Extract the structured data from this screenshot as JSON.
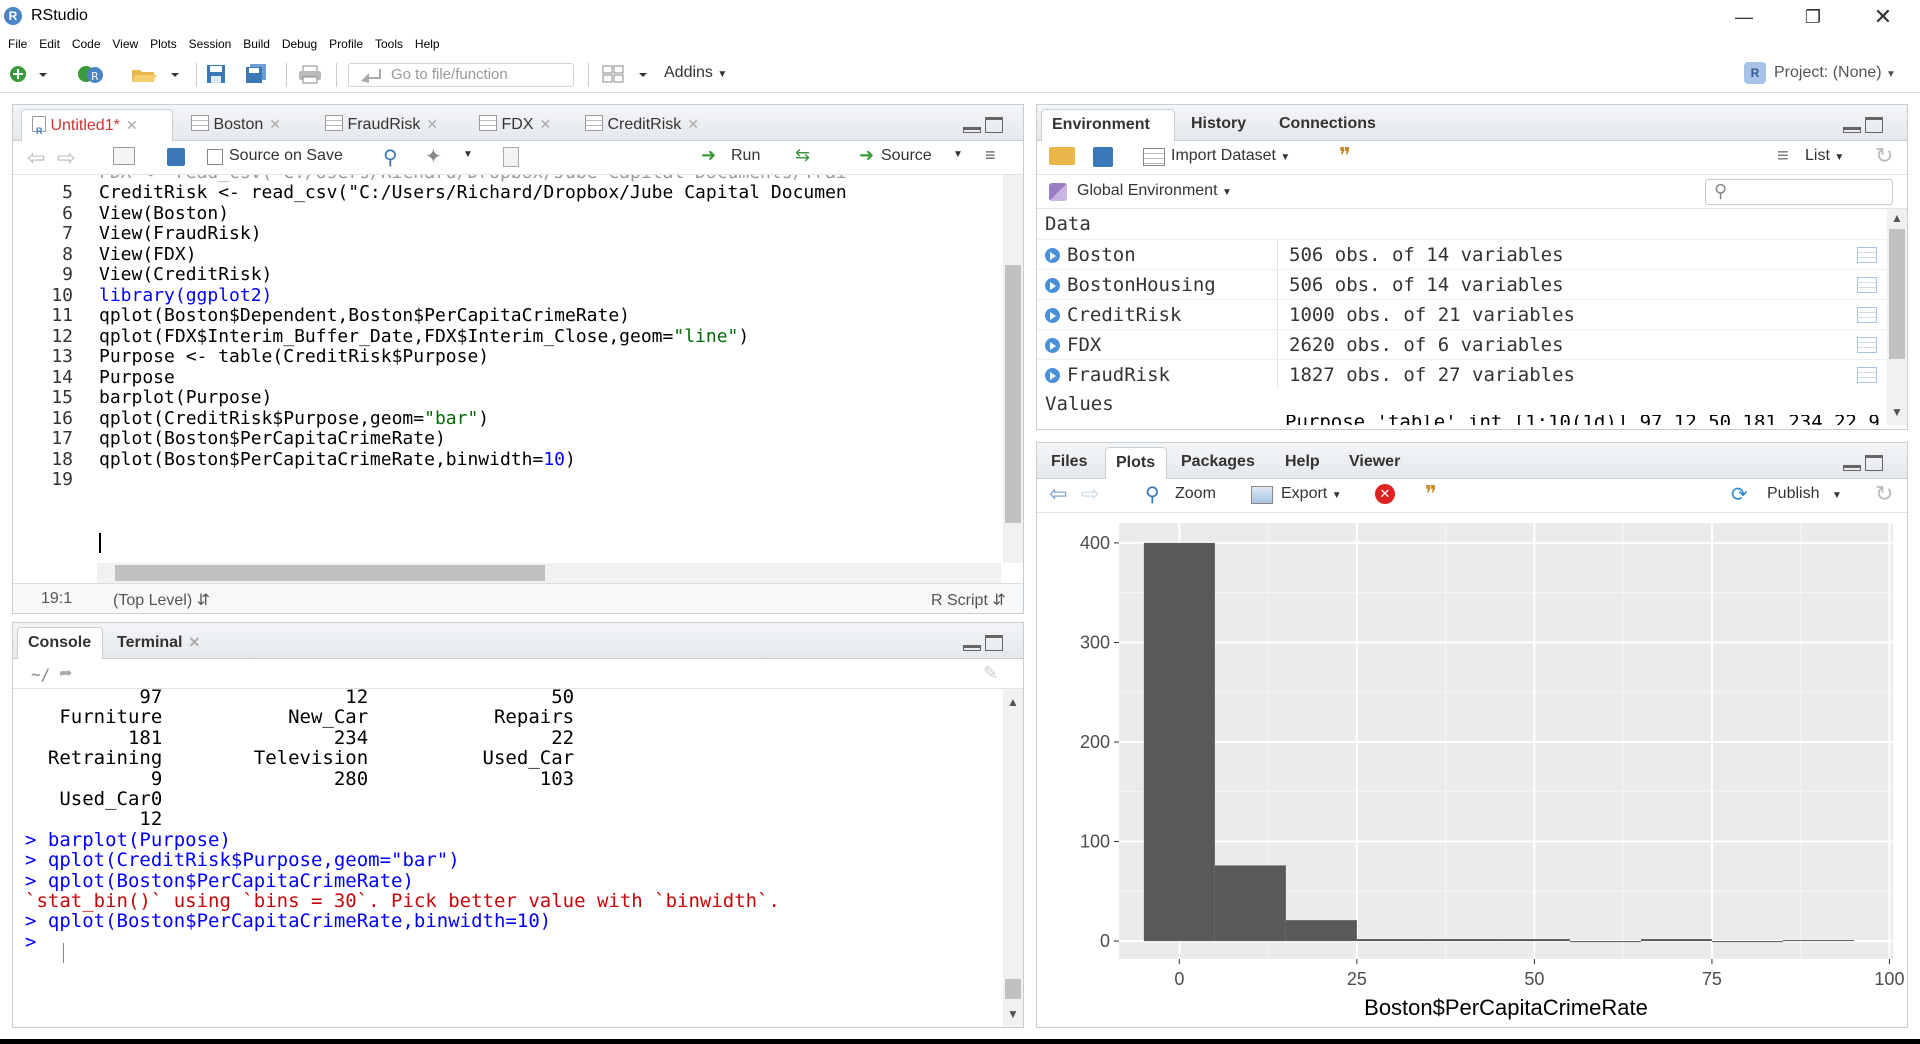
{
  "window": {
    "title": "RStudio",
    "app_icon": "R"
  },
  "menu": [
    "File",
    "Edit",
    "Code",
    "View",
    "Plots",
    "Session",
    "Build",
    "Debug",
    "Profile",
    "Tools",
    "Help"
  ],
  "toolbar": {
    "goto_placeholder": "Go to file/function",
    "addins": "Addins",
    "project": "Project: (None)"
  },
  "editor": {
    "tabs": [
      "Untitled1*",
      "Boston",
      "FraudRisk",
      "FDX",
      "CreditRisk"
    ],
    "toolbar": {
      "source_on_save": "Source on Save",
      "run": "Run",
      "source": "Source"
    },
    "lines": [
      {
        "n": "5",
        "t": "CreditRisk <- read_csv(\"C:/Users/Richard/Dropbox/Jube Capital Documen"
      },
      {
        "n": "6",
        "t": "View(Boston)"
      },
      {
        "n": "7",
        "t": "View(FraudRisk)"
      },
      {
        "n": "8",
        "t": "View(FDX)"
      },
      {
        "n": "9",
        "t": "View(CreditRisk)"
      },
      {
        "n": "10",
        "t": "library(ggplot2)"
      },
      {
        "n": "11",
        "t": "qplot(Boston$Dependent,Boston$PerCapitaCrimeRate)"
      },
      {
        "n": "12",
        "t": "qplot(FDX$Interim_Buffer_Date,FDX$Interim_Close,geom=\"line\")"
      },
      {
        "n": "13",
        "t": "Purpose <- table(CreditRisk$Purpose)"
      },
      {
        "n": "14",
        "t": "Purpose"
      },
      {
        "n": "15",
        "t": "barplot(Purpose)"
      },
      {
        "n": "16",
        "t": "qplot(CreditRisk$Purpose,geom=\"bar\")"
      },
      {
        "n": "17",
        "t": "qplot(Boston$PerCapitaCrimeRate)"
      },
      {
        "n": "18",
        "t": "qplot(Boston$PerCapitaCrimeRate,binwidth=10)"
      },
      {
        "n": "19",
        "t": ""
      }
    ],
    "partial_top_line": "FDX <- read_csv(\"C:/Users/Richard/Dropbox/Jube Capital Documents/Trai",
    "status": {
      "position": "19:1",
      "scope": "(Top Level)",
      "type": "R Script"
    }
  },
  "console": {
    "tabs": [
      "Console",
      "Terminal"
    ],
    "path": "~/",
    "output": [
      {
        "cls": "out",
        "t": "          97                12                50"
      },
      {
        "cls": "out",
        "t": "   Furniture           New_Car           Repairs"
      },
      {
        "cls": "out",
        "t": "         181               234                22"
      },
      {
        "cls": "out",
        "t": "  Retraining        Television          Used_Car"
      },
      {
        "cls": "out",
        "t": "           9               280               103"
      },
      {
        "cls": "out",
        "t": "   Used_Car0"
      },
      {
        "cls": "out",
        "t": "          12"
      },
      {
        "cls": "cmd",
        "t": "> barplot(Purpose)"
      },
      {
        "cls": "cmd",
        "t": "> qplot(CreditRisk$Purpose,geom=\"bar\")"
      },
      {
        "cls": "cmd",
        "t": "> qplot(Boston$PerCapitaCrimeRate)"
      },
      {
        "cls": "err",
        "t": "`stat_bin()` using `bins = 30`. Pick better value with `binwidth`."
      },
      {
        "cls": "cmd",
        "t": "> qplot(Boston$PerCapitaCrimeRate,binwidth=10)"
      },
      {
        "cls": "cmd",
        "t": "> "
      }
    ]
  },
  "environment": {
    "tabs": [
      "Environment",
      "History",
      "Connections"
    ],
    "import_dataset": "Import Dataset",
    "list_label": "List",
    "scope": "Global Environment",
    "section_data": "Data",
    "section_values": "Values",
    "rows": [
      {
        "name": "Boston",
        "desc": "506 obs. of 14 variables"
      },
      {
        "name": "BostonHousing",
        "desc": "506 obs. of 14 variables"
      },
      {
        "name": "CreditRisk",
        "desc": "1000 obs. of 21 variables"
      },
      {
        "name": "FDX",
        "desc": "2620 obs. of 6 variables"
      },
      {
        "name": "FraudRisk",
        "desc": "1827 obs. of 27 variables"
      }
    ],
    "partial_value": "Purpose   'table' int [1:10(1d)] 97 12 50 181 234 22 9"
  },
  "files": {
    "tabs": [
      "Files",
      "Plots",
      "Packages",
      "Help",
      "Viewer"
    ],
    "zoom": "Zoom",
    "export": "Export",
    "publish": "Publish"
  },
  "chart_data": {
    "type": "bar",
    "xlabel": "Boston$PerCapitaCrimeRate",
    "ylabel": "",
    "xlim": [
      -8.5,
      100.5
    ],
    "ylim": [
      -18,
      420
    ],
    "x_ticks": [
      "0",
      "25",
      "50",
      "75",
      "100"
    ],
    "x_tick_values": [
      0,
      25,
      50,
      75,
      100
    ],
    "y_ticks": [
      "0",
      "100",
      "200",
      "300",
      "400"
    ],
    "y_tick_values": [
      0,
      100,
      200,
      300,
      400
    ],
    "bins": [
      {
        "x0": -5,
        "x1": 5,
        "count": 400
      },
      {
        "x0": 5,
        "x1": 15,
        "count": 76
      },
      {
        "x0": 15,
        "x1": 25,
        "count": 21
      },
      {
        "x0": 25,
        "x1": 35,
        "count": 2
      },
      {
        "x0": 35,
        "x1": 45,
        "count": 2
      },
      {
        "x0": 45,
        "x1": 55,
        "count": 2
      },
      {
        "x0": 55,
        "x1": 65,
        "count": 0
      },
      {
        "x0": 65,
        "x1": 75,
        "count": 2
      },
      {
        "x0": 75,
        "x1": 85,
        "count": 0
      },
      {
        "x0": 85,
        "x1": 95,
        "count": 1
      }
    ],
    "colors": {
      "panel": "#ebebeb",
      "grid": "#ffffff",
      "bar": "#595959"
    }
  }
}
